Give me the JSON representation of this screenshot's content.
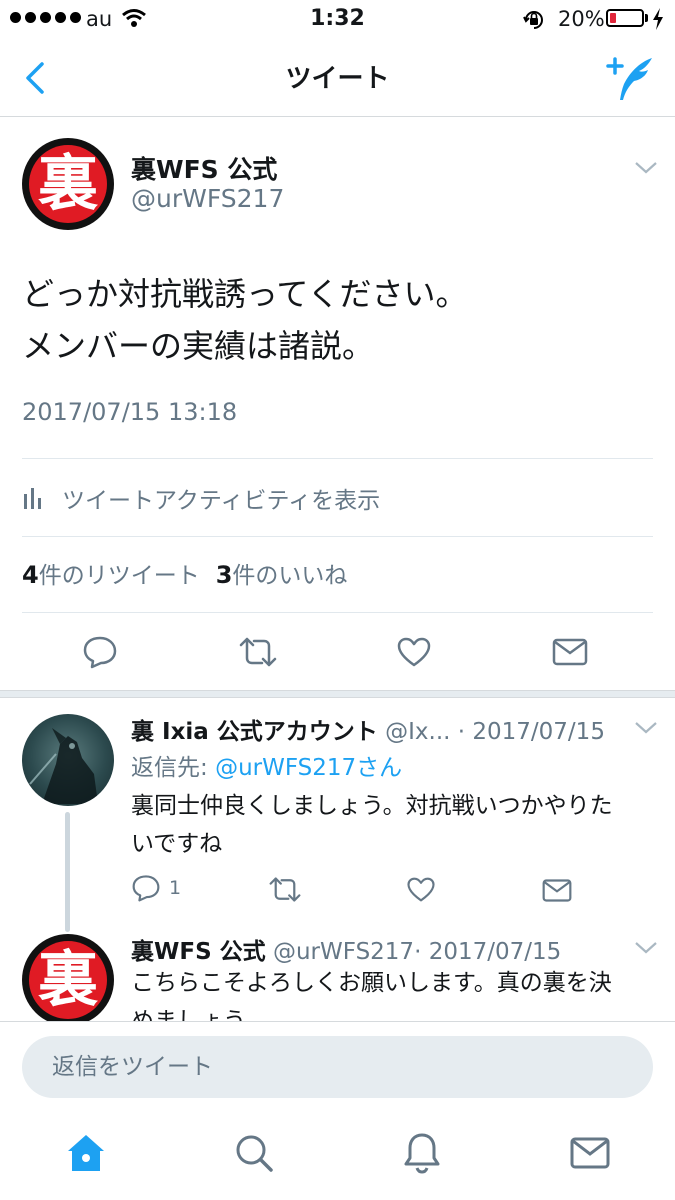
{
  "status_bar": {
    "carrier": "au",
    "time": "1:32",
    "battery_percent_label": "20%",
    "battery_level": 0.2,
    "battery_color": "#e0263b",
    "icons": [
      "signal-dots-icon",
      "wifi-icon",
      "rotation-lock-icon",
      "battery-icon",
      "charging-bolt-icon"
    ]
  },
  "nav": {
    "title": "ツイート",
    "icons": [
      "back-chevron-icon",
      "compose-tweet-icon"
    ]
  },
  "tweet": {
    "avatar_glyph": "裏",
    "display_name": "裏WFS 公式",
    "handle": "@urWFS217",
    "text_lines": [
      "どっか対抗戦誘ってください。",
      "メンバーの実績は諸説。"
    ],
    "timestamp": "2017/07/15 13:18",
    "activity_label": "ツイートアクティビティを表示",
    "retweet_count": "4",
    "retweet_label": "件のリツイート",
    "like_count": "3",
    "like_label": "件のいいね"
  },
  "replies": [
    {
      "display_name": "裏 Ixia 公式アカウント",
      "handle": "@Ix...",
      "date": "· 2017/07/15",
      "reply_to_prefix": "返信先: ",
      "reply_to_handle": "@urWFS217さん",
      "text": "裏同士仲良くしましょう。対抗戦いつかやりたいですね",
      "reply_count": "1"
    },
    {
      "avatar_glyph": "裏",
      "display_name": "裏WFS 公式",
      "handle": "@urWFS217",
      "date": "· 2017/07/15",
      "text": "こちらこそよろしくお願いします。真の裏を決めましょう。"
    }
  ],
  "composer": {
    "placeholder": "返信をツイート"
  },
  "tab_bar": {
    "icons": [
      "home-icon",
      "search-icon",
      "notifications-icon",
      "messages-icon"
    ],
    "active": "home-icon"
  },
  "colors": {
    "accent": "#1da1f2",
    "avatar_red": "#e01b24",
    "muted_text": "#657786",
    "separator": "#e6ecf0"
  }
}
